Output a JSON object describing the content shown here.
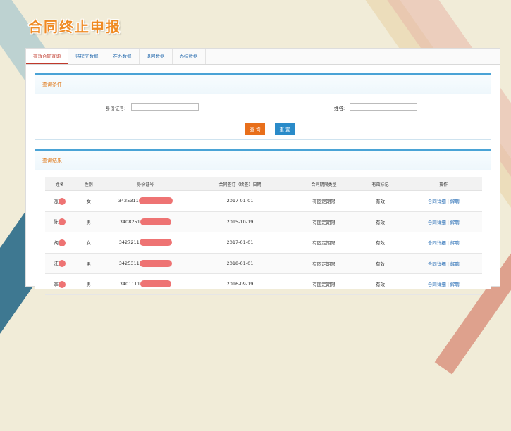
{
  "page_title": "合同终止申报",
  "tabs": [
    "有效合同查询",
    "待提交数据",
    "在办数据",
    "退回数据",
    "办结数据"
  ],
  "query": {
    "header": "查询条件",
    "id_label": "身份证号:",
    "id_value": "",
    "name_label": "姓名:",
    "name_value": "",
    "search_button": "查 询",
    "reset_button": "重 置"
  },
  "results": {
    "header": "查询结果",
    "columns": [
      "姓名",
      "性别",
      "身份证号",
      "合同签订（续签）日期",
      "合同期限类型",
      "有效标记",
      "操作"
    ],
    "rows": [
      {
        "name": "涨",
        "gender": "女",
        "id": "3425311",
        "date": "2017-01-01",
        "term": "有固定期限",
        "valid": "有效"
      },
      {
        "name": "陈",
        "gender": "男",
        "id": "3408251",
        "date": "2015-10-19",
        "term": "有固定期限",
        "valid": "有效"
      },
      {
        "name": "胡",
        "gender": "女",
        "id": "3427211",
        "date": "2017-01-01",
        "term": "有固定期限",
        "valid": "有效"
      },
      {
        "name": "汪",
        "gender": "男",
        "id": "3425311",
        "date": "2018-01-01",
        "term": "有固定期限",
        "valid": "有效"
      },
      {
        "name": "李",
        "gender": "男",
        "id": "3401111",
        "date": "2016-09-19",
        "term": "有固定期限",
        "valid": "有效"
      }
    ],
    "action_detail": "合同详细",
    "action_terminate": "解聘",
    "action_separator": "|"
  }
}
